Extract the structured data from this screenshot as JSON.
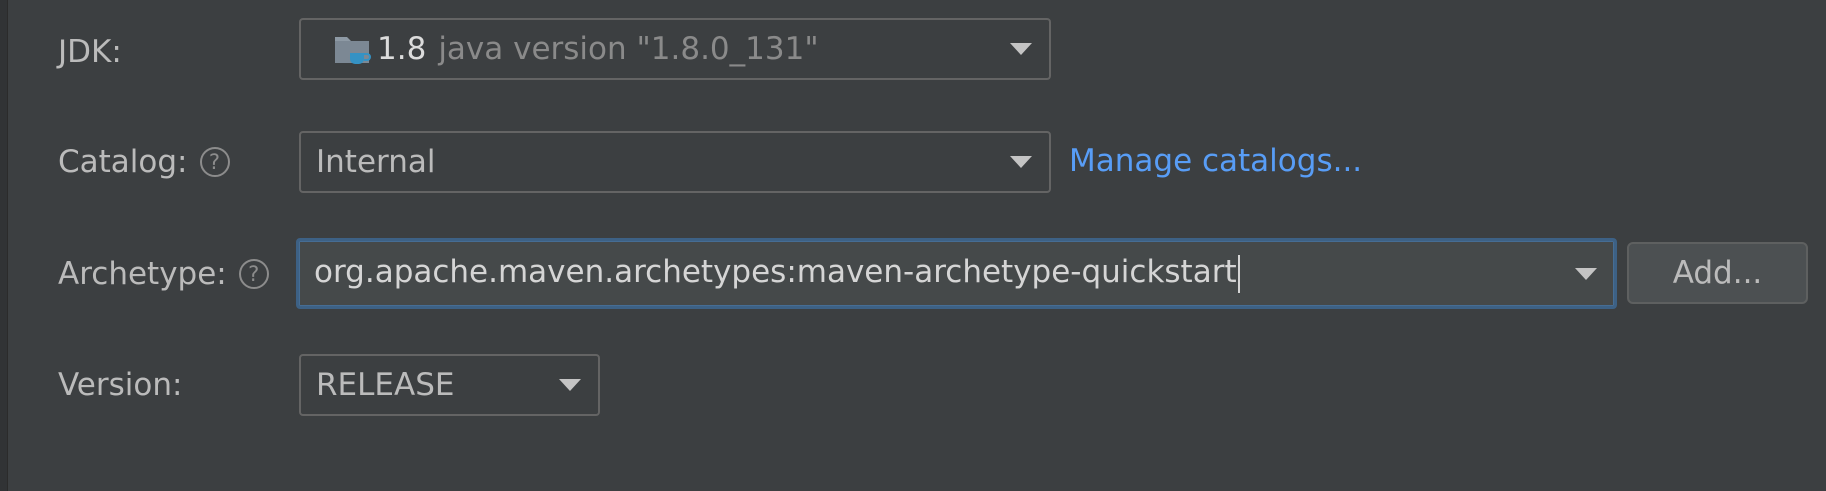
{
  "form": {
    "jdk": {
      "label": "JDK:",
      "icon": "folder-java-icon",
      "selected_main": "1.8",
      "selected_detail": "java version \"1.8.0_131\""
    },
    "catalog": {
      "label": "Catalog:",
      "value": "Internal",
      "help_glyph": "?",
      "manage_link": "Manage catalogs..."
    },
    "archetype": {
      "label": "Archetype:",
      "value": "org.apache.maven.archetypes:maven-archetype-quickstart",
      "help_glyph": "?",
      "add_button": "Add..."
    },
    "version": {
      "label": "Version:",
      "value": "RELEASE"
    }
  },
  "colors": {
    "background": "#3c3f41",
    "link": "#589df6",
    "focus_border": "#3d6185"
  }
}
